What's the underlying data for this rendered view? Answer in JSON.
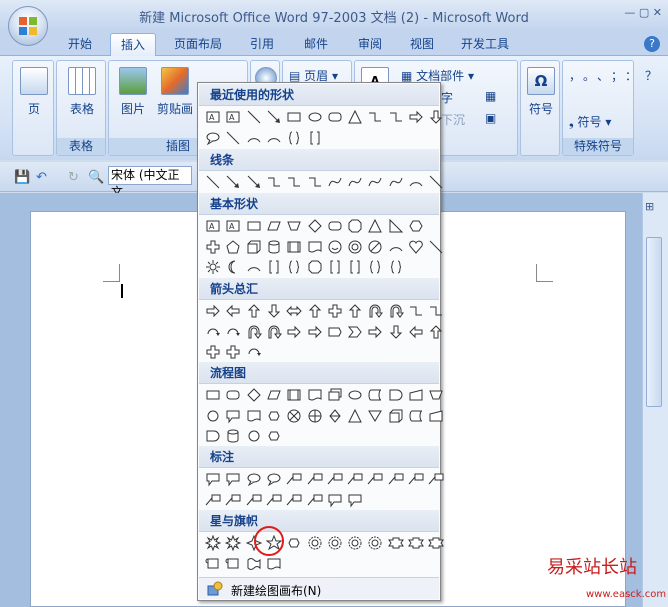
{
  "window": {
    "title": "新建 Microsoft Office Word 97-2003 文档 (2) - Microsoft Word",
    "controls": "— ▢ ✕"
  },
  "tabs": [
    "开始",
    "插入",
    "页面布局",
    "引用",
    "邮件",
    "审阅",
    "视图",
    "开发工具"
  ],
  "active_tab": "插入",
  "help": "?",
  "ribbon": {
    "pages": {
      "label": "页",
      "group": ""
    },
    "table": {
      "label": "表格",
      "group": "表格"
    },
    "picture": {
      "label": "图片",
      "clipart": "剪贴画",
      "group": "插图"
    },
    "header": {
      "label": "页眉"
    },
    "text_parts": {
      "label": "文档部件",
      "text_left": "字",
      "text_under": "下沉"
    },
    "symbol": {
      "big_label": "符号",
      "group_symbols": "",
      "special_label": "符号",
      "group_special": "特殊符号",
      "marks": "，。、；：？"
    }
  },
  "qat": {
    "font": "宋体 (中文正文"
  },
  "dropdown": {
    "sections": [
      "最近使用的形状",
      "线条",
      "基本形状",
      "箭头总汇",
      "流程图",
      "标注",
      "星与旗帜"
    ],
    "footer_label": "新建绘图画布(N)"
  },
  "watermark": {
    "text": "易采站长站",
    "url": "www.easck.com"
  },
  "colors": {
    "accent": "#15428b",
    "highlight": "#e21a1a"
  }
}
